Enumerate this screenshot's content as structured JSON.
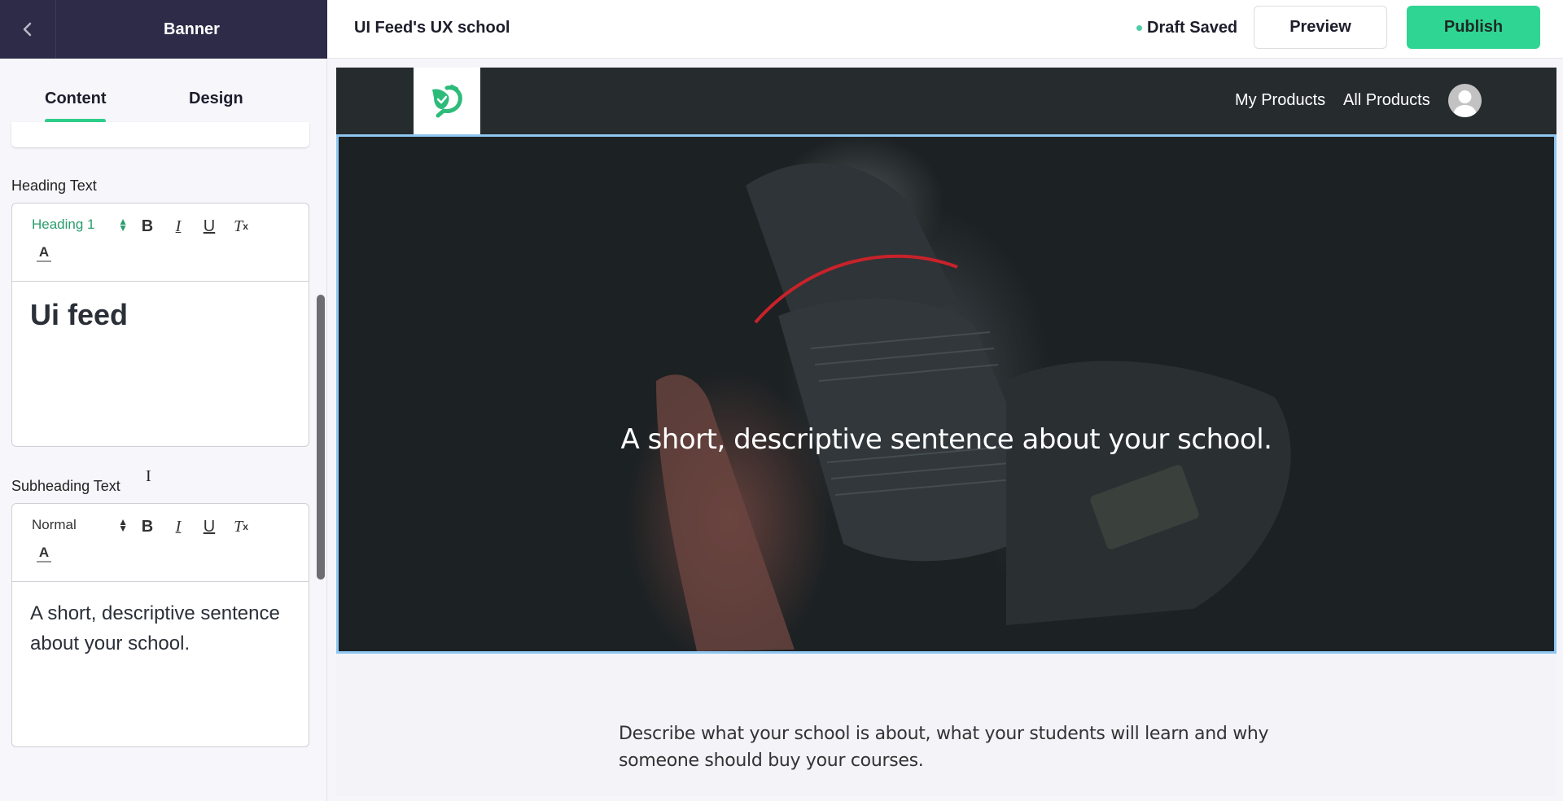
{
  "sidebar": {
    "title": "Banner",
    "back_icon": "chevron-left-icon",
    "tabs": [
      {
        "label": "Content",
        "active": true
      },
      {
        "label": "Design",
        "active": false
      }
    ],
    "fields": [
      {
        "label": "Heading Text",
        "format": "Heading 1",
        "value": "Ui feed"
      },
      {
        "label": "Subheading Text",
        "format": "Normal",
        "value": "A short, descriptive sentence about your school."
      }
    ],
    "toolbar": {
      "bold": "B",
      "italic": "I",
      "underline": "U",
      "clear_format": "T",
      "clear_format_sub": "x",
      "text_color": "A"
    }
  },
  "topbar": {
    "site_name": "UI Feed's UX school",
    "status": "Draft Saved",
    "preview_label": "Preview",
    "publish_label": "Publish"
  },
  "site": {
    "nav_links": [
      "My Products",
      "All Products"
    ],
    "banner_text": "A short, descriptive sentence about your school.",
    "description": "Describe what your school is about, what your students will learn and why someone should buy your courses."
  },
  "colors": {
    "accent": "#2dce89",
    "publish": "#2fd592",
    "header_dark": "#2d2b47",
    "format_heading": "#2a9d6e",
    "selection_border": "#8fc6f2"
  }
}
